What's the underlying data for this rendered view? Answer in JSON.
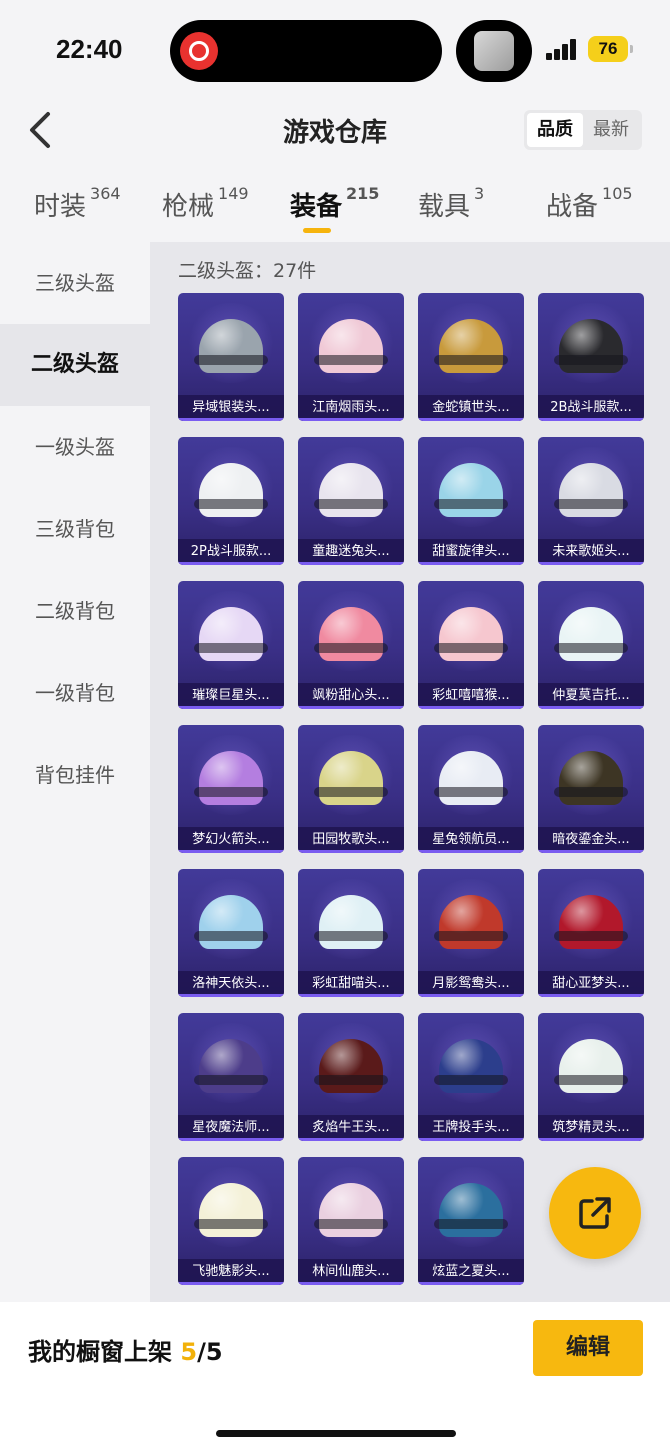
{
  "status_bar": {
    "time": "22:40",
    "battery": "76"
  },
  "header": {
    "title": "游戏仓库",
    "sort_options": [
      "品质",
      "最新"
    ],
    "sort_active": "品质"
  },
  "tabs": [
    {
      "label": "时装",
      "count": "364"
    },
    {
      "label": "枪械",
      "count": "149"
    },
    {
      "label": "装备",
      "count": "215"
    },
    {
      "label": "载具",
      "count": "3"
    },
    {
      "label": "战备",
      "count": "105"
    }
  ],
  "active_tab": "装备",
  "sidebar": {
    "items": [
      "三级头盔",
      "二级头盔",
      "一级头盔",
      "三级背包",
      "二级背包",
      "一级背包",
      "背包挂件"
    ],
    "active": "二级头盔"
  },
  "category_count": "二级头盔：27件",
  "items": [
    {
      "name": "异域银装头...",
      "color": "#9aa4ad"
    },
    {
      "name": "江南烟雨头...",
      "color": "#f0c9d6"
    },
    {
      "name": "金蛇镇世头...",
      "color": "#c89a3c"
    },
    {
      "name": "2B战斗服款...",
      "color": "#2a2a2e"
    },
    {
      "name": "2P战斗服款...",
      "color": "#eef0f2"
    },
    {
      "name": "童趣迷兔头...",
      "color": "#e8e4ee"
    },
    {
      "name": "甜蜜旋律头...",
      "color": "#9ad4e8"
    },
    {
      "name": "未来歌姬头...",
      "color": "#d9dbe3"
    },
    {
      "name": "璀璨巨星头...",
      "color": "#e6d8f5"
    },
    {
      "name": "飒粉甜心头...",
      "color": "#f08aa0"
    },
    {
      "name": "彩虹嘻嘻猴...",
      "color": "#f6c7cf"
    },
    {
      "name": "仲夏莫吉托...",
      "color": "#e9f4f5"
    },
    {
      "name": "梦幻火箭头...",
      "color": "#b47ee0"
    },
    {
      "name": "田园牧歌头...",
      "color": "#d9d48a"
    },
    {
      "name": "星兔领航员...",
      "color": "#e8ecf4"
    },
    {
      "name": "暗夜鎏金头...",
      "color": "#3d3524"
    },
    {
      "name": "洛神天依头...",
      "color": "#9fd1ec"
    },
    {
      "name": "彩虹甜喵头...",
      "color": "#dff0f5"
    },
    {
      "name": "月影鸳鸯头...",
      "color": "#c0392b"
    },
    {
      "name": "甜心亚梦头...",
      "color": "#b2182b"
    },
    {
      "name": "星夜魔法师...",
      "color": "#4d3d8a"
    },
    {
      "name": "炙焰牛王头...",
      "color": "#5a1a1a"
    },
    {
      "name": "王牌投手头...",
      "color": "#2c3e8c"
    },
    {
      "name": "筑梦精灵头...",
      "color": "#e8f0ec"
    },
    {
      "name": "飞驰魅影头...",
      "color": "#f4f1d8"
    },
    {
      "name": "林间仙鹿头...",
      "color": "#ead0e0"
    },
    {
      "name": "炫蓝之夏头...",
      "color": "#2b6f9e"
    }
  ],
  "footer": {
    "label": "我的橱窗上架",
    "current": "5",
    "total": "/5",
    "edit_label": "编辑"
  },
  "icons": {
    "back": "chevron-left-icon",
    "share": "share-external-icon"
  }
}
